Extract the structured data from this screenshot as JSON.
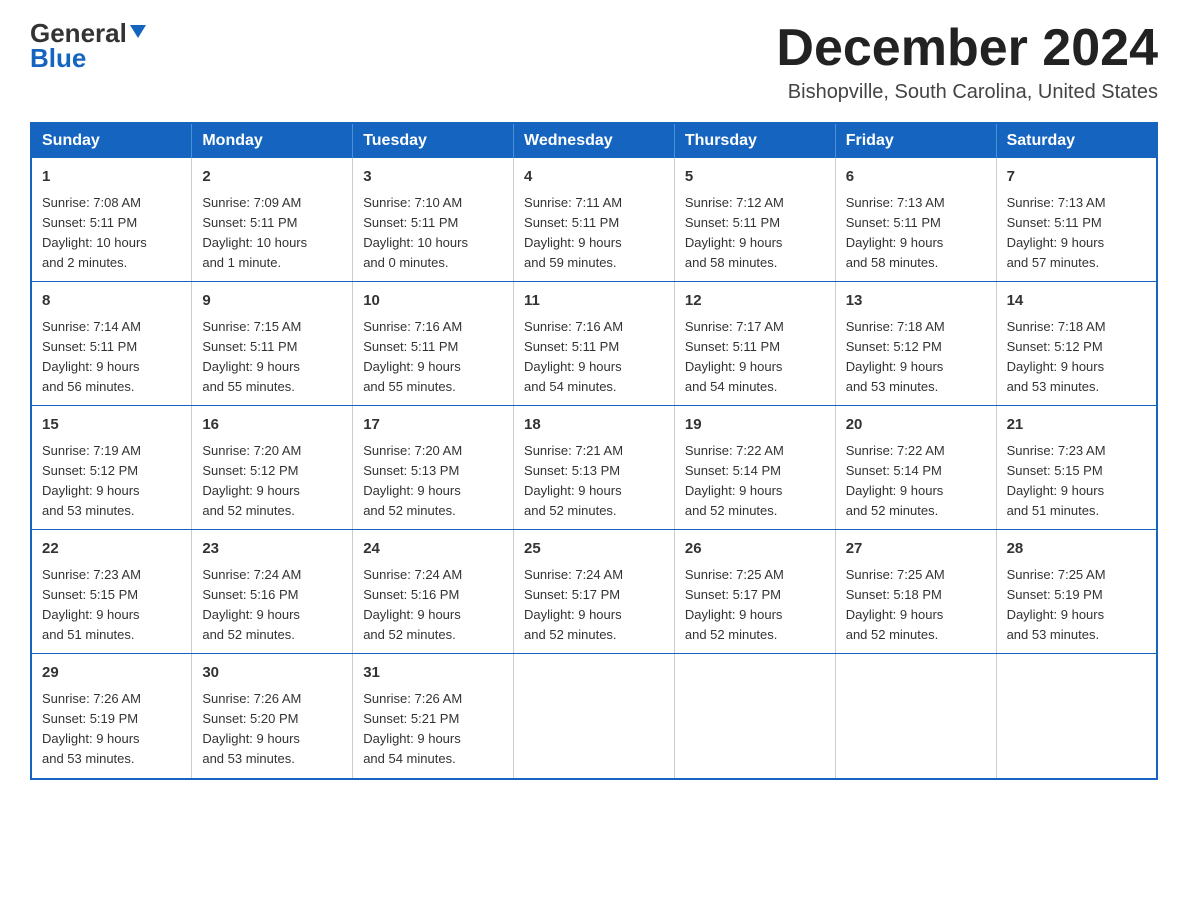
{
  "header": {
    "logo_general": "General",
    "logo_blue": "Blue",
    "month_title": "December 2024",
    "location": "Bishopville, South Carolina, United States"
  },
  "days_of_week": [
    "Sunday",
    "Monday",
    "Tuesday",
    "Wednesday",
    "Thursday",
    "Friday",
    "Saturday"
  ],
  "weeks": [
    [
      {
        "day": "1",
        "sunrise": "7:08 AM",
        "sunset": "5:11 PM",
        "daylight": "10 hours and 2 minutes."
      },
      {
        "day": "2",
        "sunrise": "7:09 AM",
        "sunset": "5:11 PM",
        "daylight": "10 hours and 1 minute."
      },
      {
        "day": "3",
        "sunrise": "7:10 AM",
        "sunset": "5:11 PM",
        "daylight": "10 hours and 0 minutes."
      },
      {
        "day": "4",
        "sunrise": "7:11 AM",
        "sunset": "5:11 PM",
        "daylight": "9 hours and 59 minutes."
      },
      {
        "day": "5",
        "sunrise": "7:12 AM",
        "sunset": "5:11 PM",
        "daylight": "9 hours and 58 minutes."
      },
      {
        "day": "6",
        "sunrise": "7:13 AM",
        "sunset": "5:11 PM",
        "daylight": "9 hours and 58 minutes."
      },
      {
        "day": "7",
        "sunrise": "7:13 AM",
        "sunset": "5:11 PM",
        "daylight": "9 hours and 57 minutes."
      }
    ],
    [
      {
        "day": "8",
        "sunrise": "7:14 AM",
        "sunset": "5:11 PM",
        "daylight": "9 hours and 56 minutes."
      },
      {
        "day": "9",
        "sunrise": "7:15 AM",
        "sunset": "5:11 PM",
        "daylight": "9 hours and 55 minutes."
      },
      {
        "day": "10",
        "sunrise": "7:16 AM",
        "sunset": "5:11 PM",
        "daylight": "9 hours and 55 minutes."
      },
      {
        "day": "11",
        "sunrise": "7:16 AM",
        "sunset": "5:11 PM",
        "daylight": "9 hours and 54 minutes."
      },
      {
        "day": "12",
        "sunrise": "7:17 AM",
        "sunset": "5:11 PM",
        "daylight": "9 hours and 54 minutes."
      },
      {
        "day": "13",
        "sunrise": "7:18 AM",
        "sunset": "5:12 PM",
        "daylight": "9 hours and 53 minutes."
      },
      {
        "day": "14",
        "sunrise": "7:18 AM",
        "sunset": "5:12 PM",
        "daylight": "9 hours and 53 minutes."
      }
    ],
    [
      {
        "day": "15",
        "sunrise": "7:19 AM",
        "sunset": "5:12 PM",
        "daylight": "9 hours and 53 minutes."
      },
      {
        "day": "16",
        "sunrise": "7:20 AM",
        "sunset": "5:12 PM",
        "daylight": "9 hours and 52 minutes."
      },
      {
        "day": "17",
        "sunrise": "7:20 AM",
        "sunset": "5:13 PM",
        "daylight": "9 hours and 52 minutes."
      },
      {
        "day": "18",
        "sunrise": "7:21 AM",
        "sunset": "5:13 PM",
        "daylight": "9 hours and 52 minutes."
      },
      {
        "day": "19",
        "sunrise": "7:22 AM",
        "sunset": "5:14 PM",
        "daylight": "9 hours and 52 minutes."
      },
      {
        "day": "20",
        "sunrise": "7:22 AM",
        "sunset": "5:14 PM",
        "daylight": "9 hours and 52 minutes."
      },
      {
        "day": "21",
        "sunrise": "7:23 AM",
        "sunset": "5:15 PM",
        "daylight": "9 hours and 51 minutes."
      }
    ],
    [
      {
        "day": "22",
        "sunrise": "7:23 AM",
        "sunset": "5:15 PM",
        "daylight": "9 hours and 51 minutes."
      },
      {
        "day": "23",
        "sunrise": "7:24 AM",
        "sunset": "5:16 PM",
        "daylight": "9 hours and 52 minutes."
      },
      {
        "day": "24",
        "sunrise": "7:24 AM",
        "sunset": "5:16 PM",
        "daylight": "9 hours and 52 minutes."
      },
      {
        "day": "25",
        "sunrise": "7:24 AM",
        "sunset": "5:17 PM",
        "daylight": "9 hours and 52 minutes."
      },
      {
        "day": "26",
        "sunrise": "7:25 AM",
        "sunset": "5:17 PM",
        "daylight": "9 hours and 52 minutes."
      },
      {
        "day": "27",
        "sunrise": "7:25 AM",
        "sunset": "5:18 PM",
        "daylight": "9 hours and 52 minutes."
      },
      {
        "day": "28",
        "sunrise": "7:25 AM",
        "sunset": "5:19 PM",
        "daylight": "9 hours and 53 minutes."
      }
    ],
    [
      {
        "day": "29",
        "sunrise": "7:26 AM",
        "sunset": "5:19 PM",
        "daylight": "9 hours and 53 minutes."
      },
      {
        "day": "30",
        "sunrise": "7:26 AM",
        "sunset": "5:20 PM",
        "daylight": "9 hours and 53 minutes."
      },
      {
        "day": "31",
        "sunrise": "7:26 AM",
        "sunset": "5:21 PM",
        "daylight": "9 hours and 54 minutes."
      },
      null,
      null,
      null,
      null
    ]
  ],
  "labels": {
    "sunrise": "Sunrise:",
    "sunset": "Sunset:",
    "daylight": "Daylight:"
  }
}
